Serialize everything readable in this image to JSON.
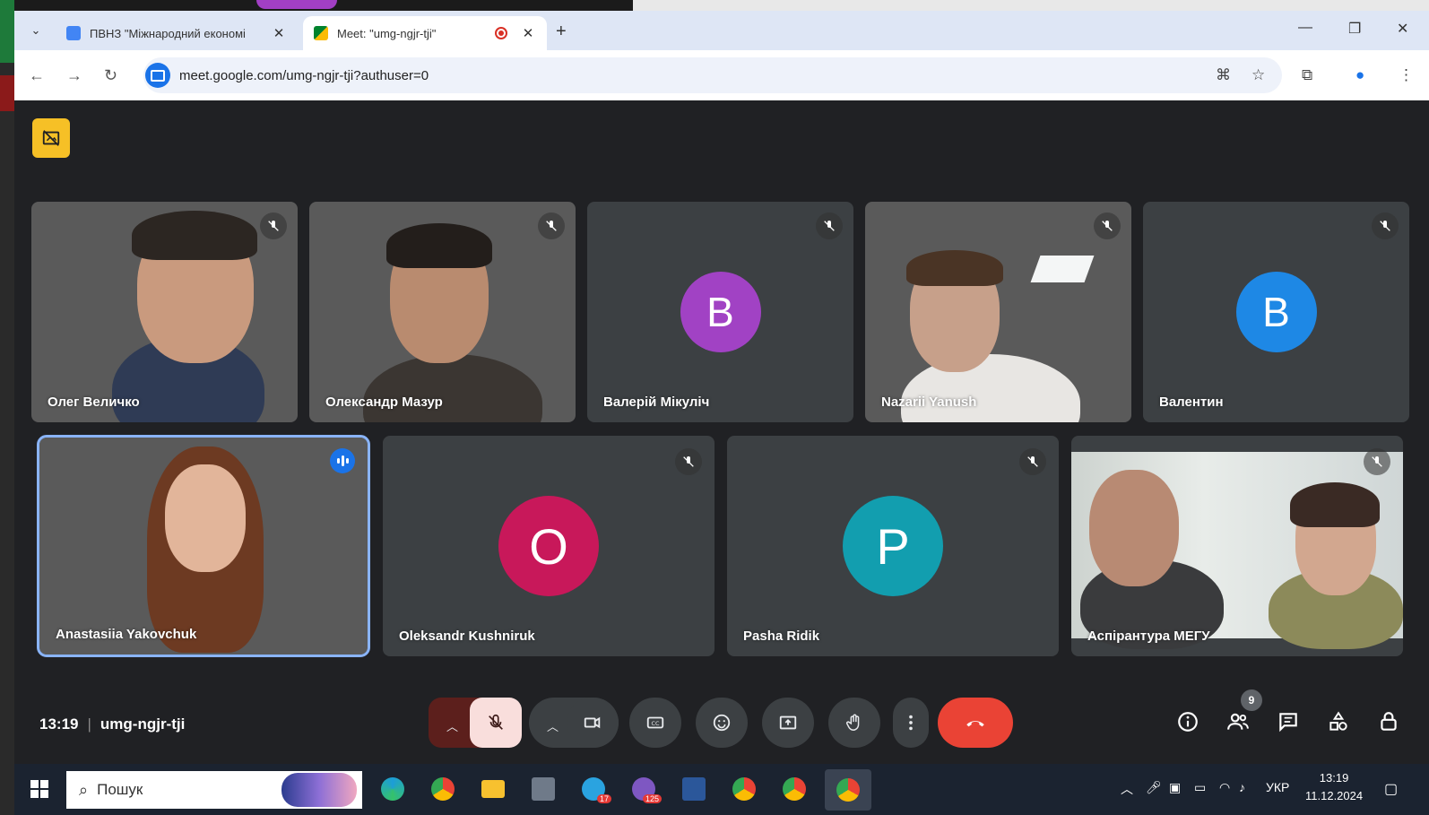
{
  "browser": {
    "tabs": [
      {
        "title": "ПВНЗ \"Міжнародний економі",
        "active": false,
        "favicon_color": "#4285f4"
      },
      {
        "title": "Meet: \"umg-ngjr-tji\"",
        "active": true,
        "favicon_color": "#00832d"
      }
    ],
    "url": "meet.google.com/umg-ngjr-tji?authuser=0"
  },
  "meeting": {
    "time": "13:19",
    "code": "umg-ngjr-tji",
    "participant_count": "9",
    "participants": [
      {
        "name": "Олег Величко",
        "type": "video",
        "muted": true
      },
      {
        "name": "Олександр Мазур",
        "type": "video",
        "muted": true
      },
      {
        "name": "Валерій Мікуліч",
        "type": "avatar",
        "initial": "В",
        "color": "#a142c4",
        "muted": true
      },
      {
        "name": "Nazarii Yanush",
        "type": "video",
        "muted": true
      },
      {
        "name": "Валентин",
        "type": "avatar",
        "initial": "В",
        "color": "#1e88e5",
        "muted": true
      },
      {
        "name": "Anastasiia Yakovchuk",
        "type": "video",
        "speaking": true
      },
      {
        "name": "Oleksandr Kushniruk",
        "type": "avatar",
        "initial": "O",
        "color": "#c8185a",
        "muted": true
      },
      {
        "name": "Pasha Ridik",
        "type": "avatar",
        "initial": "P",
        "color": "#129eaf",
        "muted": true
      },
      {
        "name": "Аспірантура МЕГУ",
        "type": "video",
        "muted": true
      }
    ],
    "accent_end_call": "#ea4335"
  },
  "taskbar": {
    "search_label": "Пошук",
    "language": "УКР",
    "time": "13:19",
    "date": "11.12.2024",
    "badges": {
      "telegram": "17",
      "viber": "125"
    }
  }
}
